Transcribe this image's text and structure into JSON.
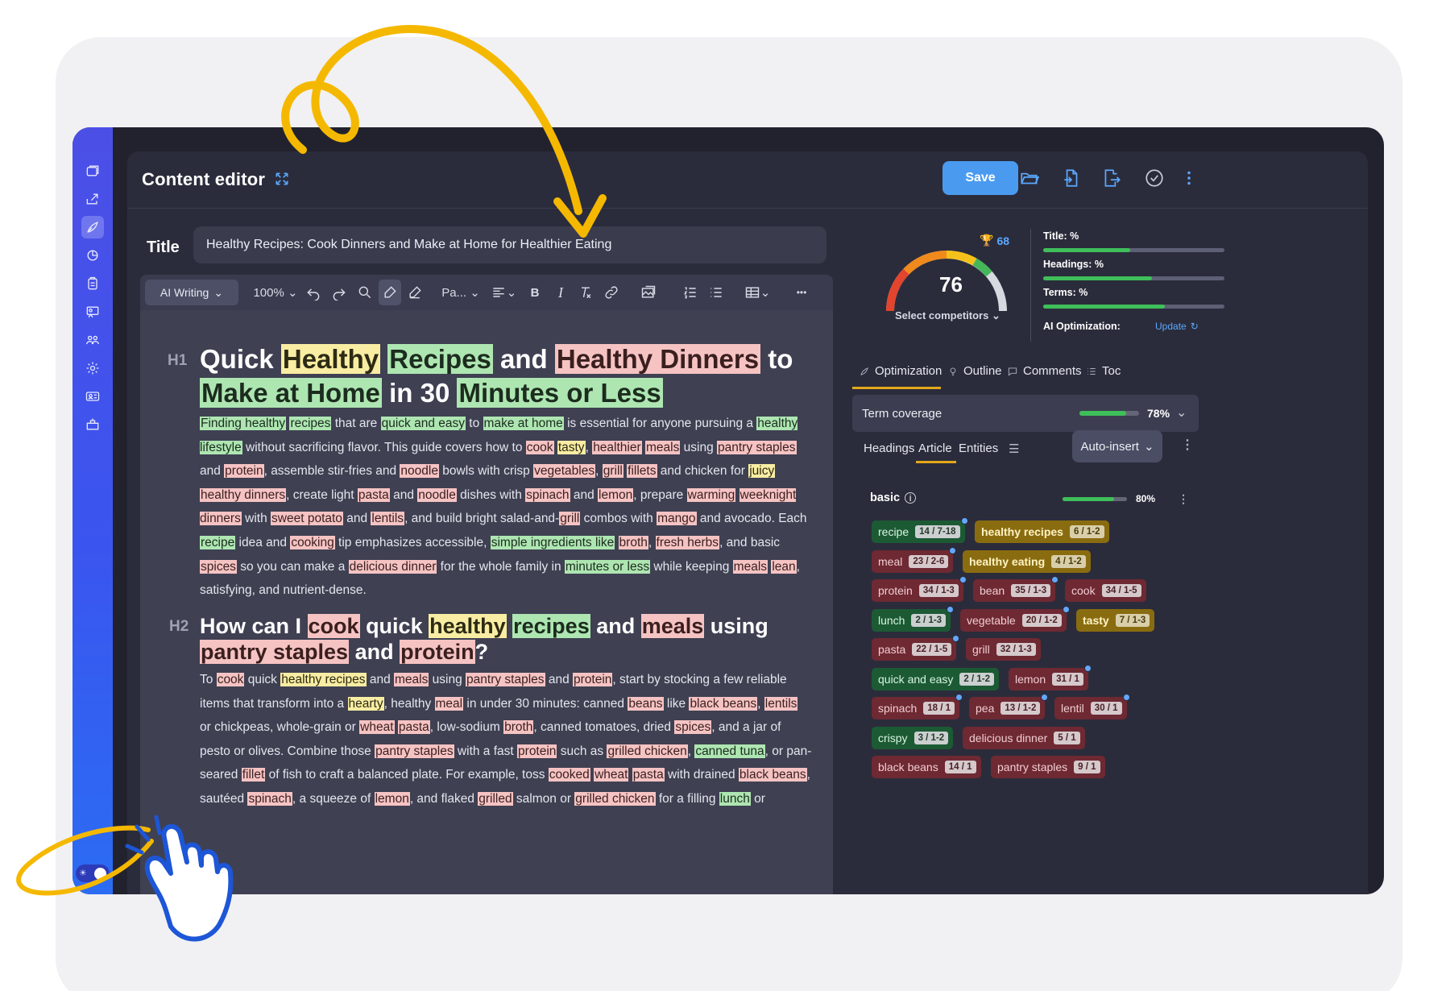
{
  "header": {
    "title": "Content editor",
    "save_label": "Save",
    "icons": [
      "expand-icon",
      "folder-open-icon",
      "import-icon",
      "export-icon",
      "check-circle-icon",
      "more-vertical-icon"
    ]
  },
  "title_field": {
    "label": "Title",
    "value": "Healthy Recipes: Cook Dinners and Make at Home for Healthier Eating"
  },
  "toolbar": {
    "ai_writing": "AI Writing",
    "zoom": "100%",
    "paragraph": "Pa...",
    "bold": "B",
    "italic": "I",
    "more": "•••"
  },
  "editor": {
    "h1_tag": "H1",
    "h2_tag": "H2",
    "h1": [
      {
        "t": "Quick ",
        "h": ""
      },
      {
        "t": "Healthy",
        "h": "y"
      },
      {
        "t": " ",
        "h": ""
      },
      {
        "t": "Recipes",
        "h": "g"
      },
      {
        "t": " and ",
        "h": ""
      },
      {
        "t": "Healthy Dinners",
        "h": "r"
      },
      {
        "t": " to ",
        "h": ""
      },
      {
        "t": "Make at Home",
        "h": "g"
      },
      {
        "t": " in 30 ",
        "h": ""
      },
      {
        "t": "Minutes or Less",
        "h": "g"
      }
    ],
    "p1": [
      {
        "t": "Finding healthy",
        "h": "g"
      },
      {
        "t": " ",
        "h": ""
      },
      {
        "t": "recipes",
        "h": "g"
      },
      {
        "t": " that are ",
        "h": ""
      },
      {
        "t": "quick and easy",
        "h": "g"
      },
      {
        "t": " to ",
        "h": ""
      },
      {
        "t": "make at home",
        "h": "g"
      },
      {
        "t": " is essential for anyone pursuing a ",
        "h": ""
      },
      {
        "t": "healthy lifestyle",
        "h": "g"
      },
      {
        "t": " without sacrificing flavor. This guide covers how to ",
        "h": ""
      },
      {
        "t": "cook",
        "h": "r"
      },
      {
        "t": " ",
        "h": ""
      },
      {
        "t": "tasty",
        "h": "y"
      },
      {
        "t": ", ",
        "h": ""
      },
      {
        "t": "healthier",
        "h": "r"
      },
      {
        "t": " ",
        "h": ""
      },
      {
        "t": "meals",
        "h": "r"
      },
      {
        "t": " using ",
        "h": ""
      },
      {
        "t": "pantry staples",
        "h": "r"
      },
      {
        "t": " and ",
        "h": ""
      },
      {
        "t": "protein",
        "h": "r"
      },
      {
        "t": ", assemble stir-fries and ",
        "h": ""
      },
      {
        "t": "noodle",
        "h": "r"
      },
      {
        "t": " bowls with crisp ",
        "h": ""
      },
      {
        "t": "vegetables",
        "h": "r"
      },
      {
        "t": ", ",
        "h": ""
      },
      {
        "t": "grill",
        "h": "r"
      },
      {
        "t": " ",
        "h": ""
      },
      {
        "t": "fillets",
        "h": "r"
      },
      {
        "t": " and chicken for ",
        "h": ""
      },
      {
        "t": "juicy",
        "h": "y"
      },
      {
        "t": " ",
        "h": ""
      },
      {
        "t": "healthy dinners",
        "h": "r"
      },
      {
        "t": ", create light ",
        "h": ""
      },
      {
        "t": "pasta",
        "h": "r"
      },
      {
        "t": " and ",
        "h": ""
      },
      {
        "t": "noodle",
        "h": "r"
      },
      {
        "t": " dishes with ",
        "h": ""
      },
      {
        "t": "spinach",
        "h": "r"
      },
      {
        "t": " and ",
        "h": ""
      },
      {
        "t": "lemon",
        "h": "r"
      },
      {
        "t": ", prepare ",
        "h": ""
      },
      {
        "t": "warming",
        "h": "r"
      },
      {
        "t": " ",
        "h": ""
      },
      {
        "t": "weeknight dinners",
        "h": "r"
      },
      {
        "t": " with ",
        "h": ""
      },
      {
        "t": "sweet potato",
        "h": "r"
      },
      {
        "t": " and ",
        "h": ""
      },
      {
        "t": "lentils",
        "h": "r"
      },
      {
        "t": ", and build bright salad-and-",
        "h": ""
      },
      {
        "t": "grill",
        "h": "r"
      },
      {
        "t": " combos with ",
        "h": ""
      },
      {
        "t": "mango",
        "h": "r"
      },
      {
        "t": " and avocado. Each ",
        "h": ""
      },
      {
        "t": "recipe",
        "h": "g"
      },
      {
        "t": " idea and ",
        "h": ""
      },
      {
        "t": "cooking",
        "h": "r"
      },
      {
        "t": " tip emphasizes accessible, ",
        "h": ""
      },
      {
        "t": "simple ingredients like",
        "h": "g"
      },
      {
        "t": " ",
        "h": ""
      },
      {
        "t": "broth",
        "h": "r"
      },
      {
        "t": ", ",
        "h": ""
      },
      {
        "t": "fresh herbs",
        "h": "r"
      },
      {
        "t": ", and basic ",
        "h": ""
      },
      {
        "t": "spices",
        "h": "r"
      },
      {
        "t": " so you can make a ",
        "h": ""
      },
      {
        "t": "delicious dinner",
        "h": "r"
      },
      {
        "t": " for the whole family in ",
        "h": ""
      },
      {
        "t": "minutes or less",
        "h": "g"
      },
      {
        "t": " while keeping ",
        "h": ""
      },
      {
        "t": "meals",
        "h": "r"
      },
      {
        "t": " ",
        "h": ""
      },
      {
        "t": "lean",
        "h": "r"
      },
      {
        "t": ", satisfying, and nutrient-dense.",
        "h": ""
      }
    ],
    "h2": [
      {
        "t": "How can I ",
        "h": ""
      },
      {
        "t": "cook",
        "h": "r"
      },
      {
        "t": " quick ",
        "h": ""
      },
      {
        "t": "healthy",
        "h": "y"
      },
      {
        "t": " ",
        "h": ""
      },
      {
        "t": "recipes",
        "h": "g"
      },
      {
        "t": " and ",
        "h": ""
      },
      {
        "t": "meals",
        "h": "r"
      },
      {
        "t": " using ",
        "h": ""
      },
      {
        "t": "pantry staples",
        "h": "r"
      },
      {
        "t": " and ",
        "h": ""
      },
      {
        "t": "protein",
        "h": "r"
      },
      {
        "t": "?",
        "h": ""
      }
    ],
    "p2": [
      {
        "t": "To ",
        "h": ""
      },
      {
        "t": "cook",
        "h": "r"
      },
      {
        "t": " quick ",
        "h": ""
      },
      {
        "t": "healthy recipes",
        "h": "y"
      },
      {
        "t": " and ",
        "h": ""
      },
      {
        "t": "meals",
        "h": "r"
      },
      {
        "t": " using ",
        "h": ""
      },
      {
        "t": "pantry staples",
        "h": "r"
      },
      {
        "t": " and ",
        "h": ""
      },
      {
        "t": "protein",
        "h": "r"
      },
      {
        "t": ", start by stocking a few reliable items that transform into a ",
        "h": ""
      },
      {
        "t": "hearty",
        "h": "y"
      },
      {
        "t": ", healthy ",
        "h": ""
      },
      {
        "t": "meal",
        "h": "r"
      },
      {
        "t": " in under 30 minutes: canned ",
        "h": ""
      },
      {
        "t": "beans",
        "h": "r"
      },
      {
        "t": " like ",
        "h": ""
      },
      {
        "t": "black beans",
        "h": "r"
      },
      {
        "t": ", ",
        "h": ""
      },
      {
        "t": "lentils",
        "h": "r"
      },
      {
        "t": " or chickpeas, whole-grain or ",
        "h": ""
      },
      {
        "t": "wheat",
        "h": "r"
      },
      {
        "t": " ",
        "h": ""
      },
      {
        "t": "pasta",
        "h": "r"
      },
      {
        "t": ", low-sodium ",
        "h": ""
      },
      {
        "t": "broth",
        "h": "r"
      },
      {
        "t": ", canned tomatoes, dried ",
        "h": ""
      },
      {
        "t": "spices",
        "h": "r"
      },
      {
        "t": ", and a jar of pesto or olives. Combine those ",
        "h": ""
      },
      {
        "t": "pantry staples",
        "h": "r"
      },
      {
        "t": " with a fast ",
        "h": ""
      },
      {
        "t": "protein",
        "h": "r"
      },
      {
        "t": " such as ",
        "h": ""
      },
      {
        "t": "grilled chicken",
        "h": "r"
      },
      {
        "t": ", ",
        "h": ""
      },
      {
        "t": "canned tuna",
        "h": "g"
      },
      {
        "t": ", or pan-seared ",
        "h": ""
      },
      {
        "t": "fillet",
        "h": "r"
      },
      {
        "t": " of fish to craft a balanced plate. For example, toss ",
        "h": ""
      },
      {
        "t": "cooked",
        "h": "r"
      },
      {
        "t": " ",
        "h": ""
      },
      {
        "t": "wheat",
        "h": "r"
      },
      {
        "t": " ",
        "h": ""
      },
      {
        "t": "pasta",
        "h": "r"
      },
      {
        "t": " with drained ",
        "h": ""
      },
      {
        "t": "black beans",
        "h": "r"
      },
      {
        "t": ", sautéed ",
        "h": ""
      },
      {
        "t": "spinach",
        "h": "r"
      },
      {
        "t": ", a squeeze of ",
        "h": ""
      },
      {
        "t": "lemon",
        "h": "r"
      },
      {
        "t": ", and flaked ",
        "h": ""
      },
      {
        "t": "grilled",
        "h": "r"
      },
      {
        "t": " salmon or ",
        "h": ""
      },
      {
        "t": "grilled chicken",
        "h": "r"
      },
      {
        "t": " for a filling ",
        "h": ""
      },
      {
        "t": "lunch",
        "h": "g"
      },
      {
        "t": " or",
        "h": ""
      }
    ]
  },
  "score": {
    "value": "76",
    "competitor_score": "68",
    "select_competitors": "Select competitors",
    "gauge_fraction": 0.76
  },
  "metrics": [
    {
      "label": "Title: %",
      "fill": 0.48
    },
    {
      "label": "Headings: %",
      "fill": 0.6
    },
    {
      "label": "Terms: %",
      "fill": 0.67
    }
  ],
  "ai_optimization": {
    "label": "AI Optimization:",
    "update": "Update"
  },
  "right_tabs": [
    "Optimization",
    "Outline",
    "Comments",
    "Toc"
  ],
  "term_coverage": {
    "label": "Term coverage",
    "pct": "78%",
    "fill": 0.78
  },
  "sub_tabs": [
    "Headings",
    "Article",
    "Entities"
  ],
  "auto_insert": "Auto-insert",
  "basic": {
    "label": "basic",
    "pct": "80%",
    "fill": 0.8
  },
  "terms": [
    [
      {
        "name": "recipe",
        "count": "14 / 7-18",
        "c": "g",
        "dot": true
      },
      {
        "name": "healthy recipes",
        "count": "6 / 1-2",
        "c": "y",
        "dot": false
      }
    ],
    [
      {
        "name": "meal",
        "count": "23 / 2-6",
        "c": "r",
        "dot": true
      },
      {
        "name": "healthy eating",
        "count": "4 / 1-2",
        "c": "y",
        "dot": false
      }
    ],
    [
      {
        "name": "protein",
        "count": "34 / 1-3",
        "c": "r",
        "dot": true
      },
      {
        "name": "bean",
        "count": "35 / 1-3",
        "c": "r",
        "dot": true
      },
      {
        "name": "cook",
        "count": "34 / 1-5",
        "c": "r",
        "dot": false
      }
    ],
    [
      {
        "name": "lunch",
        "count": "2 / 1-3",
        "c": "g",
        "dot": true
      },
      {
        "name": "vegetable",
        "count": "20 / 1-2",
        "c": "r",
        "dot": true
      },
      {
        "name": "tasty",
        "count": "7 / 1-3",
        "c": "y",
        "dot": false
      }
    ],
    [
      {
        "name": "pasta",
        "count": "22 / 1-5",
        "c": "r",
        "dot": true
      },
      {
        "name": "grill",
        "count": "32 / 1-3",
        "c": "r",
        "dot": false
      }
    ],
    [
      {
        "name": "quick and easy",
        "count": "2 / 1-2",
        "c": "g",
        "dot": false
      },
      {
        "name": "lemon",
        "count": "31 / 1",
        "c": "r",
        "dot": true
      }
    ],
    [
      {
        "name": "spinach",
        "count": "18 / 1",
        "c": "r",
        "dot": true
      },
      {
        "name": "pea",
        "count": "13 / 1-2",
        "c": "r",
        "dot": true
      },
      {
        "name": "lentil",
        "count": "30 / 1",
        "c": "r",
        "dot": true
      }
    ],
    [
      {
        "name": "crispy",
        "count": "3 / 1-2",
        "c": "g",
        "dot": false
      },
      {
        "name": "delicious dinner",
        "count": "5 / 1",
        "c": "r",
        "dot": false
      }
    ],
    [
      {
        "name": "black beans",
        "count": "14 / 1",
        "c": "r",
        "dot": false
      },
      {
        "name": "pantry staples",
        "count": "9 / 1",
        "c": "r",
        "dot": false
      }
    ]
  ],
  "colors": {
    "rail": "#3a55ef",
    "accent": "#4a9bf0",
    "good": "#3fbf5a",
    "annotation": "#f5b800",
    "tab_underline": "#e2a81b"
  }
}
